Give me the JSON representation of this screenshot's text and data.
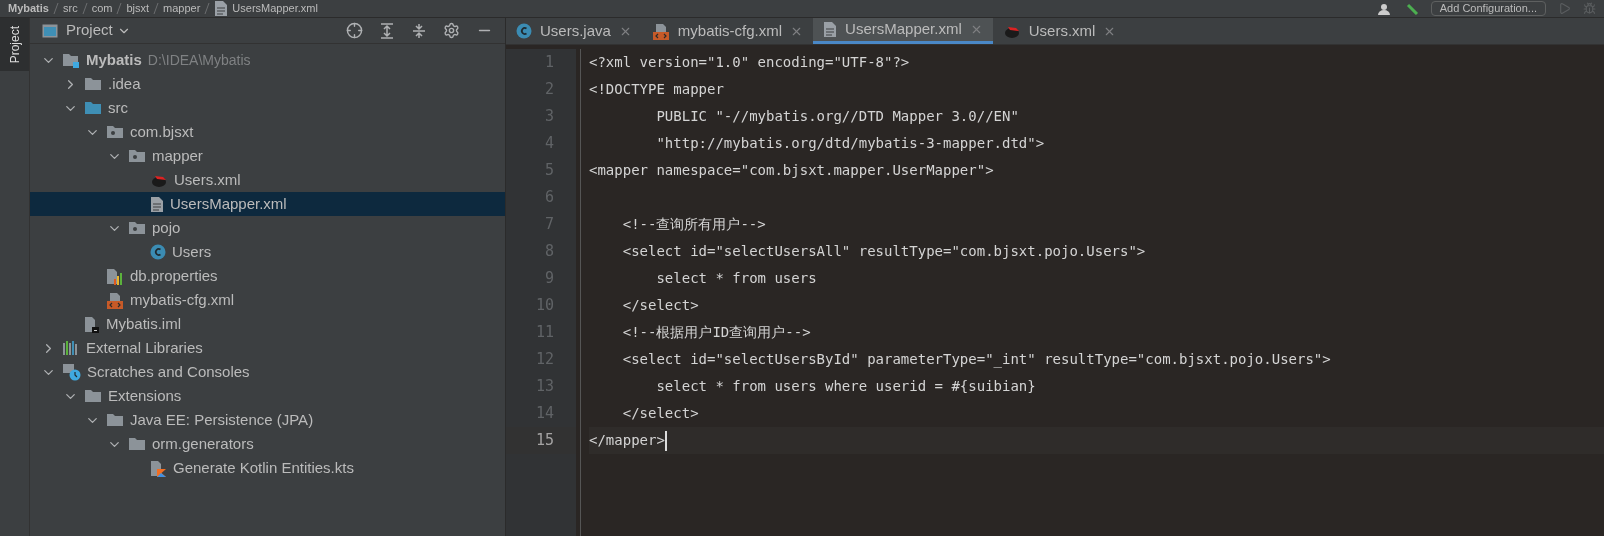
{
  "breadcrumb": [
    {
      "label": "Mybatis",
      "kind": "text"
    },
    {
      "label": "src",
      "kind": "text"
    },
    {
      "label": "com",
      "kind": "text"
    },
    {
      "label": "bjsxt",
      "kind": "text"
    },
    {
      "label": "mapper",
      "kind": "text"
    },
    {
      "label": "UsersMapper.xml",
      "kind": "file"
    }
  ],
  "toolbar": {
    "run_config": "Add Configuration..."
  },
  "side_tab": {
    "label": "Project",
    "selected": true
  },
  "project_panel": {
    "title": "Project",
    "tree": [
      {
        "label": "Mybatis",
        "hint": "D:\\IDEA\\Mybatis",
        "kind": "module",
        "expanded": true,
        "selected": false,
        "children": [
          {
            "label": ".idea",
            "kind": "folder",
            "expanded": false,
            "selected": false
          },
          {
            "label": "src",
            "kind": "source",
            "expanded": true,
            "selected": false,
            "children": [
              {
                "label": "com.bjsxt",
                "kind": "package",
                "expanded": true,
                "selected": false,
                "children": [
                  {
                    "label": "mapper",
                    "kind": "package",
                    "expanded": true,
                    "selected": false,
                    "children": [
                      {
                        "label": "Users.xml",
                        "kind": "bird",
                        "selected": false
                      },
                      {
                        "label": "UsersMapper.xml",
                        "kind": "text",
                        "selected": true
                      }
                    ]
                  },
                  {
                    "label": "pojo",
                    "kind": "package",
                    "expanded": true,
                    "selected": false,
                    "children": [
                      {
                        "label": "Users",
                        "kind": "class",
                        "selected": false
                      }
                    ]
                  }
                ]
              },
              {
                "label": "db.properties",
                "kind": "properties",
                "selected": false
              },
              {
                "label": "mybatis-cfg.xml",
                "kind": "xml",
                "selected": false
              }
            ]
          },
          {
            "label": "Mybatis.iml",
            "kind": "iml",
            "selected": false
          }
        ]
      },
      {
        "label": "External Libraries",
        "kind": "libraries",
        "expanded": false,
        "selected": false
      },
      {
        "label": "Scratches and Consoles",
        "kind": "scratches",
        "expanded": true,
        "selected": false,
        "children": [
          {
            "label": "Extensions",
            "kind": "folder",
            "expanded": true,
            "selected": false,
            "children": [
              {
                "label": "Java EE: Persistence (JPA)",
                "kind": "folder",
                "expanded": true,
                "selected": false,
                "children": [
                  {
                    "label": "orm.generators",
                    "kind": "folder",
                    "expanded": true,
                    "selected": false,
                    "children": [
                      {
                        "label": "Generate Kotlin Entities.kts",
                        "kind": "kts",
                        "selected": false
                      }
                    ]
                  }
                ]
              }
            ]
          }
        ]
      }
    ]
  },
  "tabs": [
    {
      "label": "Users.java",
      "kind": "class",
      "selected": false
    },
    {
      "label": "mybatis-cfg.xml",
      "kind": "xml",
      "selected": false
    },
    {
      "label": "UsersMapper.xml",
      "kind": "text",
      "selected": true
    },
    {
      "label": "Users.xml",
      "kind": "bird",
      "selected": false
    }
  ],
  "editor": {
    "lines": [
      {
        "number": "1",
        "code": "<?xml version=\"1.0\" encoding=\"UTF-8\"?>",
        "current": false
      },
      {
        "number": "2",
        "code": "<!DOCTYPE mapper",
        "current": false
      },
      {
        "number": "3",
        "code": "        PUBLIC \"-//mybatis.org//DTD Mapper 3.0//EN\"",
        "current": false
      },
      {
        "number": "4",
        "code": "        \"http://mybatis.org/dtd/mybatis-3-mapper.dtd\">",
        "current": false
      },
      {
        "number": "5",
        "code": "<mapper namespace=\"com.bjsxt.mapper.UserMapper\">",
        "current": false
      },
      {
        "number": "6",
        "current": false
      },
      {
        "number": "7",
        "code": "    <!--查询所有用户-->",
        "current": false
      },
      {
        "number": "8",
        "code": "    <select id=\"selectUsersAll\" resultType=\"com.bjsxt.pojo.Users\">",
        "current": false
      },
      {
        "number": "9",
        "code": "        select * from users",
        "current": false
      },
      {
        "number": "10",
        "code": "    </select>",
        "current": false
      },
      {
        "number": "11",
        "code": "    <!--根据用户ID查询用户-->",
        "current": false
      },
      {
        "number": "12",
        "code": "    <select id=\"selectUsersById\" parameterType=\"_int\" resultType=\"com.bjsxt.pojo.Users\">",
        "current": false
      },
      {
        "number": "13",
        "code": "        select * from users where userid = #{suibian}",
        "current": false
      },
      {
        "number": "14",
        "code": "    </select>",
        "current": false
      },
      {
        "number": "15",
        "code": "</mapper>",
        "current": true
      }
    ]
  }
}
